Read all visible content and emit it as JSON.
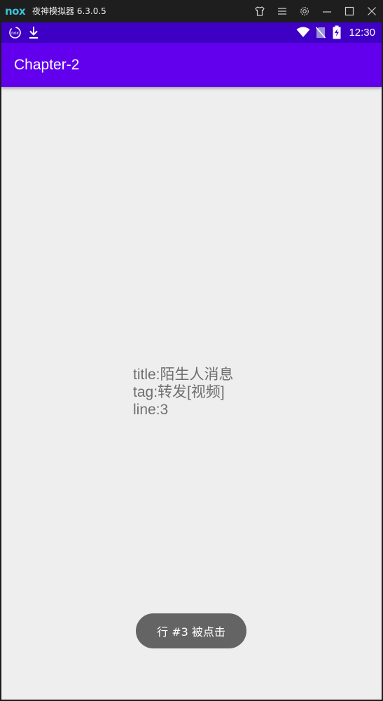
{
  "emulator": {
    "logo": "nox",
    "title": "夜神模拟器 6.3.0.5",
    "controls": [
      "shirt-icon",
      "menu-icon",
      "gear-icon",
      "minimize-icon",
      "maximize-icon",
      "close-icon"
    ]
  },
  "statusbar": {
    "left_icons": [
      "nox-circle-icon",
      "download-icon"
    ],
    "right_icons": [
      "wifi-icon",
      "no-sim-icon",
      "battery-charging-icon"
    ],
    "time": "12:30"
  },
  "appbar": {
    "title": "Chapter-2",
    "color": "#6200ee"
  },
  "content": {
    "title_line": "title:陌生人消息",
    "tag_line": "tag:转发[视频]",
    "line_line": "line:3"
  },
  "toast": {
    "text": "行 #3 被点击"
  },
  "colors": {
    "statusbar": "#3e00c4",
    "appbar": "#6200ee",
    "background": "#eeeeee",
    "toast": "#646464"
  }
}
